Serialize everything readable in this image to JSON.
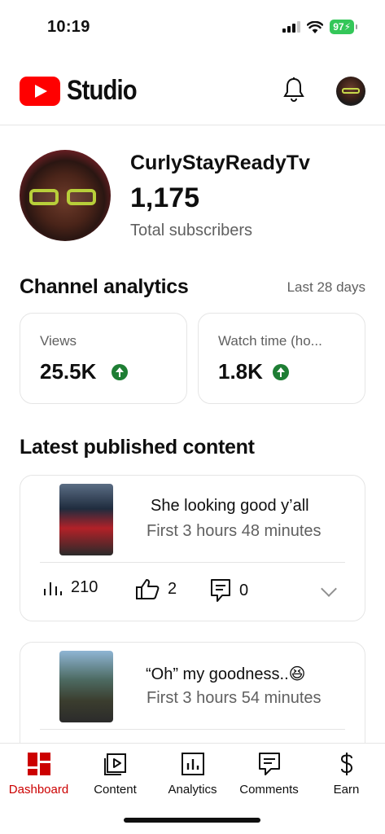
{
  "status_bar": {
    "time": "10:19",
    "battery": "97"
  },
  "header": {
    "logo_text": "Studio"
  },
  "channel": {
    "name": "CurlyStayReadyTv",
    "subscribers": "1,175",
    "subscribers_label": "Total subscribers"
  },
  "analytics": {
    "title": "Channel analytics",
    "range": "Last 28 days",
    "metrics": [
      {
        "label": "Views",
        "value": "25.5K",
        "trend": "up"
      },
      {
        "label": "Watch time (ho...",
        "value": "1.8K",
        "trend": "up"
      }
    ]
  },
  "latest": {
    "title": "Latest published content",
    "videos": [
      {
        "title": "She looking good y’all",
        "subtitle": "First 3 hours 48 minutes",
        "views": "210",
        "likes": "2",
        "comments": "0"
      },
      {
        "title": "“Oh” my goodness..😆",
        "subtitle": "First 3 hours 54 minutes"
      }
    ]
  },
  "nav": {
    "items": [
      {
        "label": "Dashboard",
        "icon": "dashboard-icon",
        "active": true
      },
      {
        "label": "Content",
        "icon": "content-icon"
      },
      {
        "label": "Analytics",
        "icon": "analytics-icon"
      },
      {
        "label": "Comments",
        "icon": "comments-icon"
      },
      {
        "label": "Earn",
        "icon": "earn-icon"
      }
    ]
  },
  "colors": {
    "brand_red": "#ff0000",
    "active_red": "#cc0000",
    "trend_green": "#1e7e34",
    "battery_green": "#34c759"
  }
}
